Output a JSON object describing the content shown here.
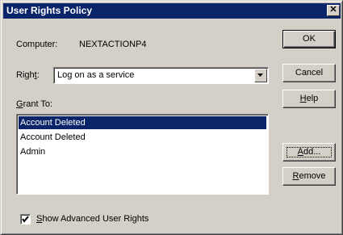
{
  "dialog": {
    "title": "User Rights Policy",
    "close_symbol": "✕"
  },
  "computer": {
    "label": "Computer:",
    "value": "NEXTACTIONP4"
  },
  "right": {
    "label_prefix": "Righ",
    "label_accel": "t",
    "label_suffix": ":",
    "selected": "Log on as a service"
  },
  "grant_to": {
    "label_accel": "G",
    "label_rest": "rant To:",
    "items": [
      {
        "label": "Account Deleted",
        "selected": true
      },
      {
        "label": "Account Deleted",
        "selected": false
      },
      {
        "label": "Admin",
        "selected": false
      }
    ]
  },
  "buttons": {
    "ok": "OK",
    "cancel": "Cancel",
    "help_accel": "H",
    "help_rest": "elp",
    "add_accel": "A",
    "add_rest": "dd...",
    "remove_accel": "R",
    "remove_rest": "emove"
  },
  "advanced": {
    "checked": true,
    "label_accel": "S",
    "label_rest": "how Advanced User Rights"
  },
  "colors": {
    "face": "#d4d0c8",
    "title_bar": "#0a246a",
    "selection": "#0a246a"
  }
}
